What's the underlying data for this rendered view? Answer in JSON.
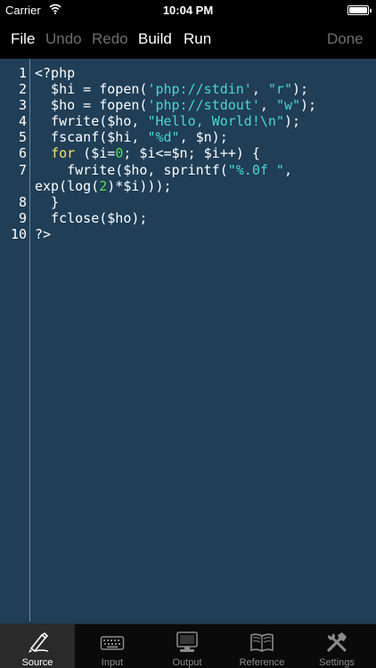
{
  "status_bar": {
    "carrier": "Carrier",
    "time": "10:04 PM"
  },
  "toolbar": {
    "file": "File",
    "undo": "Undo",
    "redo": "Redo",
    "build": "Build",
    "run": "Run",
    "done": "Done"
  },
  "editor": {
    "line_numbers": [
      "1",
      "2",
      "3",
      "4",
      "5",
      "6",
      "7",
      "8",
      "9",
      "10"
    ],
    "code_lines": [
      "<?php",
      "  $hi = fopen('php://stdin', \"r\");",
      "  $ho = fopen('php://stdout', \"w\");",
      "  fwrite($ho, \"Hello, World!\\n\");",
      "  fscanf($hi, \"%d\", $n);",
      "  for ($i=0; $i<=$n; $i++) {",
      "    fwrite($ho, sprintf(\"%.0f \",",
      "exp(log(2)*$i)));",
      "  }",
      "  fclose($ho);",
      "?>"
    ]
  },
  "tabs": [
    {
      "label": "Source",
      "icon": "fountain-pen-icon"
    },
    {
      "label": "Input",
      "icon": "keyboard-icon"
    },
    {
      "label": "Output",
      "icon": "monitor-icon"
    },
    {
      "label": "Reference",
      "icon": "book-icon"
    },
    {
      "label": "Settings",
      "icon": "tools-icon"
    }
  ],
  "colors": {
    "editor_bg": "#203e56",
    "string": "#49d7d3",
    "keyword": "#f5e46a",
    "number": "#5bd95b"
  }
}
